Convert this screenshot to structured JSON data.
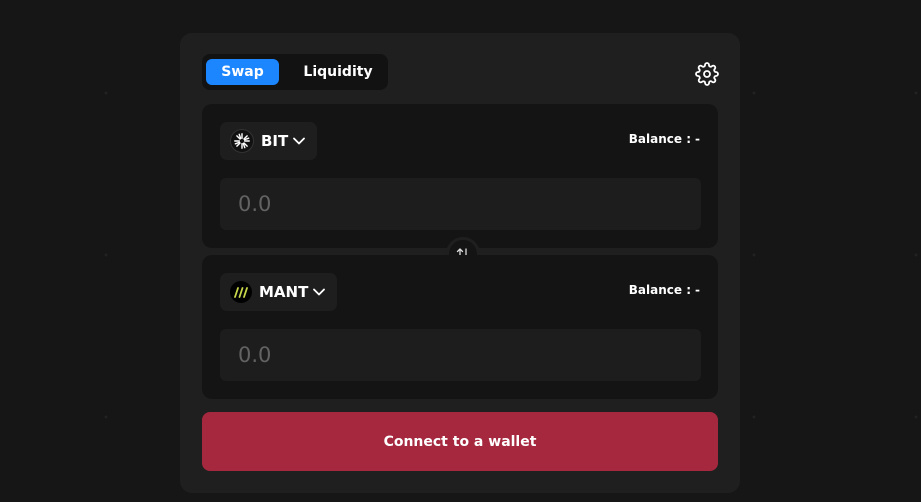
{
  "tabs": [
    {
      "label": "Swap",
      "active": true
    },
    {
      "label": "Liquidity",
      "active": false
    }
  ],
  "settings_icon": "gear-icon",
  "from": {
    "token_symbol": "BIT",
    "token_icon": "bit-token-logo",
    "balance_label": "Balance :",
    "balance_value": "-",
    "amount_placeholder": "0.0"
  },
  "switch_icon": "swap-arrows-icon",
  "to": {
    "token_symbol": "MANT",
    "token_icon": "mant-token-logo",
    "balance_label": "Balance :",
    "balance_value": "-",
    "amount_placeholder": "0.0"
  },
  "connect_button": "Connect to a wallet",
  "colors": {
    "accent": "#1c86ff",
    "connect": "#a5283f",
    "background": "#161616",
    "card": "#1f1f1f"
  }
}
